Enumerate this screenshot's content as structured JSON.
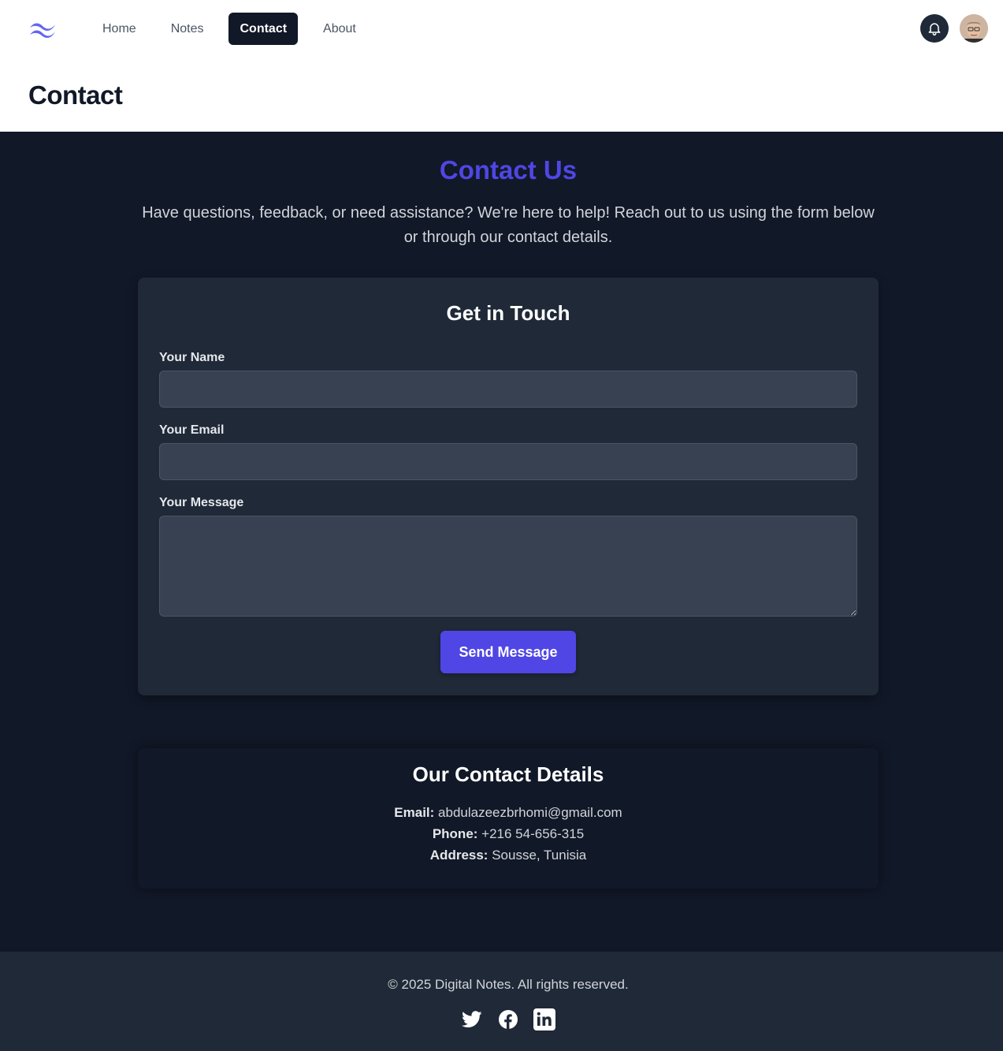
{
  "nav": {
    "logo_icon": "tailwind-waves-icon",
    "links": [
      {
        "label": "Home",
        "active": false
      },
      {
        "label": "Notes",
        "active": false
      },
      {
        "label": "Contact",
        "active": true
      },
      {
        "label": "About",
        "active": false
      }
    ],
    "notification_icon": "bell-icon",
    "avatar_icon": "user-avatar"
  },
  "page": {
    "title": "Contact"
  },
  "hero": {
    "title": "Contact Us",
    "text": "Have questions, feedback, or need assistance? We're here to help! Reach out to us using the form below or through our contact details."
  },
  "form": {
    "title": "Get in Touch",
    "name_label": "Your Name",
    "name_value": "",
    "email_label": "Your Email",
    "email_value": "",
    "message_label": "Your Message",
    "message_value": "",
    "submit_label": "Send Message"
  },
  "details": {
    "title": "Our Contact Details",
    "email_label": "Email:",
    "email_value": "abdulazeezbrhomi@gmail.com",
    "phone_label": "Phone:",
    "phone_value": "+216 54-656-315",
    "address_label": "Address:",
    "address_value": "Sousse, Tunisia"
  },
  "footer": {
    "copyright": "© 2025 Digital Notes. All rights reserved.",
    "socials": [
      "twitter-icon",
      "facebook-icon",
      "linkedin-icon"
    ]
  },
  "colors": {
    "accent": "#4f46e5",
    "background": "#111827",
    "card": "#1f2937",
    "input": "#374151"
  }
}
